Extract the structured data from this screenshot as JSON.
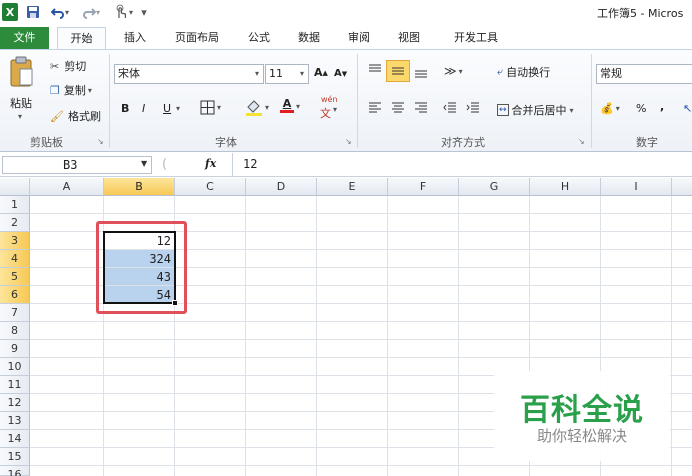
{
  "window": {
    "title": "工作簿5 - Micros"
  },
  "qat": {
    "excel_icon": "X",
    "save_icon": "save-icon",
    "undo_icon": "undo-icon",
    "redo_icon": "redo-icon",
    "touch_icon": "touch-icon",
    "customize": "▾"
  },
  "tabs": [
    {
      "label": "文件"
    },
    {
      "label": "开始"
    },
    {
      "label": "插入"
    },
    {
      "label": "页面布局"
    },
    {
      "label": "公式"
    },
    {
      "label": "数据"
    },
    {
      "label": "审阅"
    },
    {
      "label": "视图"
    },
    {
      "label": "开发工具"
    }
  ],
  "ribbon": {
    "clipboard": {
      "paste": "粘贴",
      "cut": "剪切",
      "copy": "复制",
      "format_painter": "格式刷",
      "group_label": "剪贴板"
    },
    "font": {
      "font_name": "宋体",
      "font_size": "11",
      "bold": "B",
      "italic": "I",
      "underline": "U",
      "group_label": "字体"
    },
    "alignment": {
      "wrap_text": "自动换行",
      "merge_center": "合并后居中",
      "group_label": "对齐方式"
    },
    "number": {
      "format": "常规",
      "percent": "%",
      "comma": ",",
      "group_label": "数字"
    }
  },
  "formula_bar": {
    "name_box": "B3",
    "fx": "fx",
    "value": "12"
  },
  "columns": [
    "A",
    "B",
    "C",
    "D",
    "E",
    "F",
    "G",
    "H",
    "I"
  ],
  "selected_column": "B",
  "rows": [
    "1",
    "2",
    "3",
    "4",
    "5",
    "6",
    "7",
    "8",
    "9",
    "10",
    "11",
    "12",
    "13",
    "14",
    "15",
    "16"
  ],
  "selected_rows": [
    "3",
    "4",
    "5",
    "6"
  ],
  "cells": {
    "B3": "12",
    "B4": "324",
    "B5": "43",
    "B6": "54"
  },
  "watermark": {
    "title": "百科全说",
    "subtitle": "助你轻松解决"
  },
  "colors": {
    "accent_green": "#2d8c3c",
    "highlight": "#b9d3ee",
    "annotation_red": "#e0505a"
  }
}
